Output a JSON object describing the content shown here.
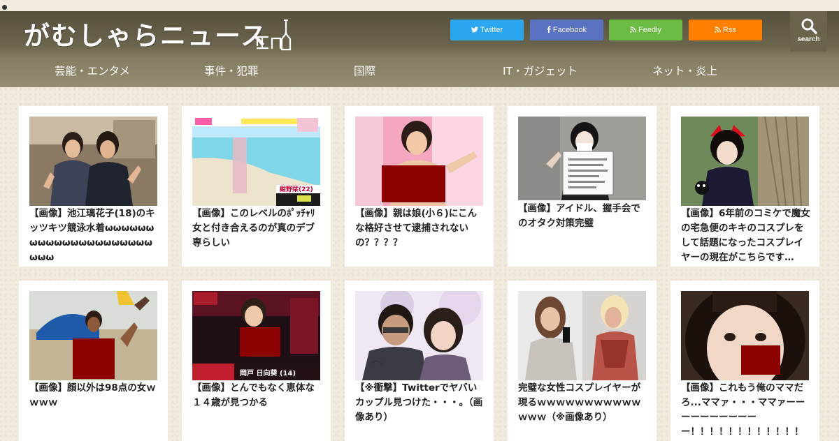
{
  "site": {
    "logo": "がむしゃらニュース"
  },
  "social": [
    {
      "label": "Twitter",
      "color": "#2ba6f0"
    },
    {
      "label": "Facebook",
      "color": "#5a72c1"
    },
    {
      "label": "Feedly",
      "color": "#6bbb44"
    },
    {
      "label": "Rss",
      "color": "#ff7f00"
    }
  ],
  "search": {
    "label": "search"
  },
  "nav": [
    "芸能・エンタメ",
    "事件・犯罪",
    "国際",
    "IT・ガジェット",
    "ネット・炎上"
  ],
  "articles": [
    {
      "title": "【画像】池江璃花子(18)のキッツキツ競泳水着ωωωωωωωωωωωωωωωωωωωωωωωω",
      "overlay": ""
    },
    {
      "title": "【画像】このレベルのﾎﾟｯﾁｬﾘ女と付き合えるのが真のデブ専らしい",
      "overlay": "紺野栞(22)"
    },
    {
      "title": "【画像】親は娘(小６)にこんな格好させて逮捕されないの？？？？",
      "overlay": ""
    },
    {
      "title": "【画像】アイドル、握手会でのオタク対策完璧",
      "overlay": ""
    },
    {
      "title": "【画像】6年前のコミケで魔女の宅急便のキキのコスプレをして話題になったコスプレイヤーの現在がこちらです…",
      "overlay": ""
    },
    {
      "title": "【画像】顔以外は98点の女ｗｗｗｗ",
      "overlay": ""
    },
    {
      "title": "【画像】とんでもなく恵体な１４歳が見つかる",
      "overlay": "岡戸 日向葵 (14)"
    },
    {
      "title": "【※衝撃】Twitterでヤバいカップル見つけた・・・。（画像あり）",
      "overlay": ""
    },
    {
      "title": "完璧な女性コスプレイヤーが現るｗｗｗｗｗｗｗｗｗｗｗｗｗｗ（※画像あり）",
      "overlay": ""
    },
    {
      "title": "【画像】これもう俺のママだろ...ママァ・・・ママァーーーーーーーーーーー！！！！！！！！！！！！",
      "overlay": ""
    }
  ]
}
